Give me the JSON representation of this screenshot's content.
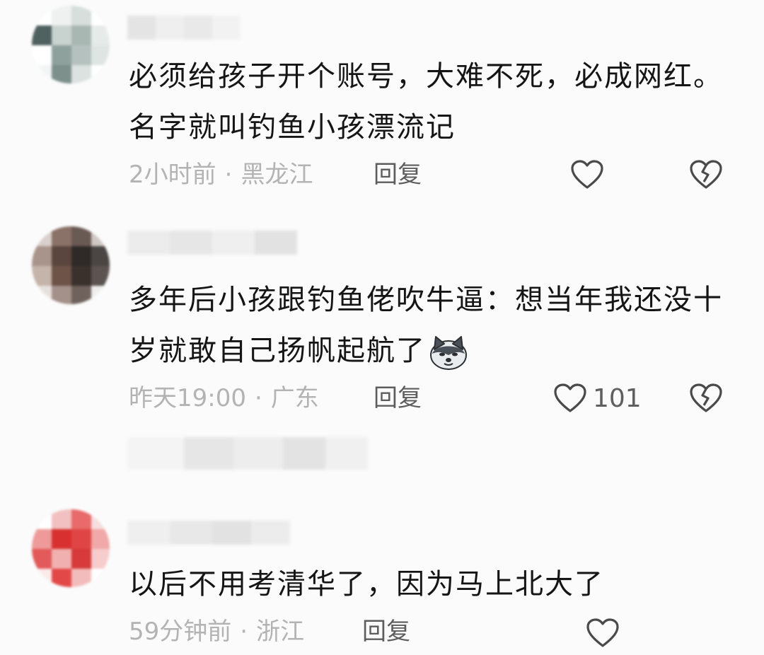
{
  "comments": [
    {
      "text": "必须给孩子开个账号，大难不死，必成网红。名字就叫钓鱼小孩漂流记",
      "time": "2小时前",
      "location": "黑龙江",
      "reply_label": "回复",
      "like_count": "",
      "colors": {
        "avatar": "#9aa8a4"
      }
    },
    {
      "text": "多年后小孩跟钓鱼佬吹牛逼：想当年我还没十岁就敢自己扬帆起航了",
      "emoji": "dog-emoji",
      "time": "昨天19:00",
      "location": "广东",
      "reply_label": "回复",
      "like_count": "101",
      "colors": {
        "avatar": "#4a3a34"
      }
    },
    {
      "text": "以后不用考清华了，因为马上北大了",
      "time": "59分钟前",
      "location": "浙江",
      "reply_label": "回复",
      "like_count": "",
      "colors": {
        "avatar": "#d83a3a"
      }
    }
  ],
  "separator_dot": "·",
  "icons": {
    "like": "heart-outline-icon",
    "dislike": "broken-heart-icon"
  },
  "colors": {
    "meta": "#b3b3b3",
    "reply": "#5d5d5d",
    "icon": "#4a4a4a",
    "background": "#fbfbfb"
  }
}
